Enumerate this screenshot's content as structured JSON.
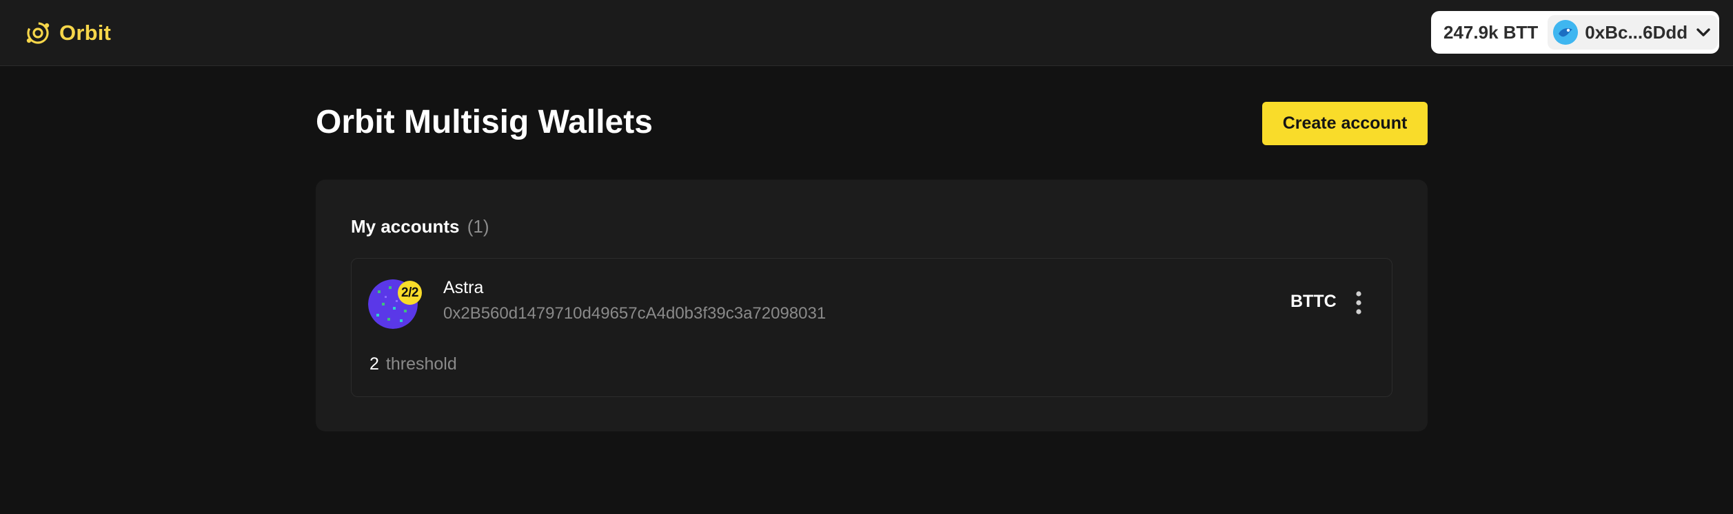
{
  "header": {
    "brand": "Orbit",
    "brand_color": "#f6d64a",
    "brand_icon": "orbit-logo-icon",
    "balance": "247.9k BTT",
    "address": "0xBc...6Ddd",
    "address_avatar_icon": "wallet-avatar-icon",
    "dropdown_icon": "chevron-down-icon"
  },
  "page": {
    "title": "Orbit Multisig Wallets",
    "create_label": "Create account",
    "accent_color": "#f9dc2a"
  },
  "accounts": {
    "title": "My accounts",
    "count": "(1)",
    "items": [
      {
        "name": "Astra",
        "address": "0x2B560d1479710d49657cA4d0b3f39c3a72098031",
        "badge": "2/2",
        "network": "BTTC",
        "threshold_value": "2",
        "threshold_label": "threshold",
        "avatar_icon": "identicon-avatar",
        "menu_icon": "more-vertical-icon"
      }
    ]
  }
}
